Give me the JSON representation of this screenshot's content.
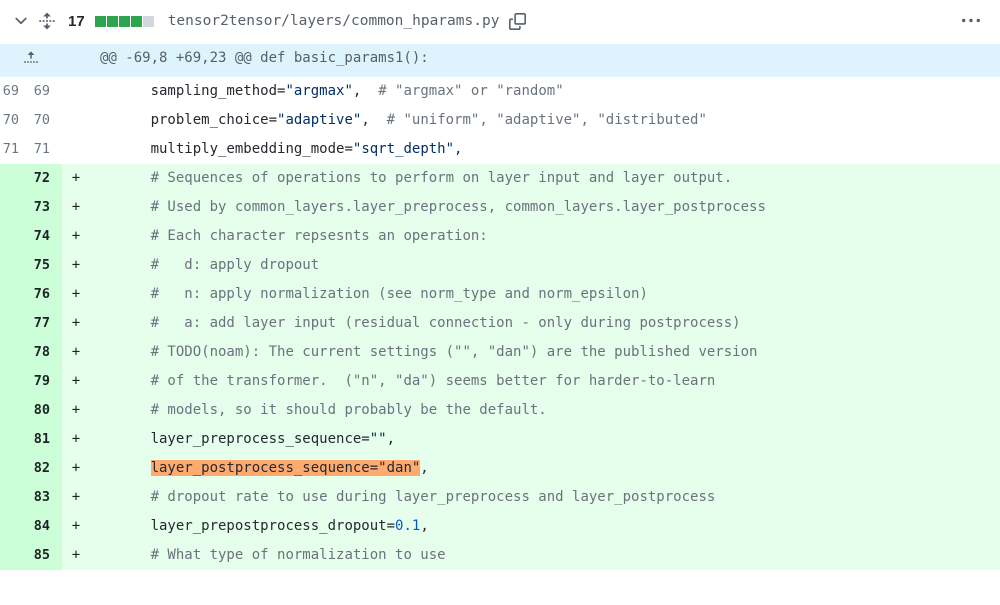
{
  "header": {
    "change_count": "17",
    "file_path": "tensor2tensor/layers/common_hparams.py"
  },
  "hunk_header": "@@ -69,8 +69,23 @@ def basic_params1():",
  "lines": [
    {
      "old": "69",
      "new": "69",
      "type": "context",
      "marker": "",
      "segs": [
        {
          "t": "      "
        },
        {
          "cls": "tok-param",
          "t": "sampling_method"
        },
        {
          "t": "="
        },
        {
          "cls": "tok-str",
          "t": "\"argmax\""
        },
        {
          "t": ",  "
        },
        {
          "cls": "tok-comment",
          "t": "# \"argmax\" or \"random\""
        }
      ]
    },
    {
      "old": "70",
      "new": "70",
      "type": "context",
      "marker": "",
      "segs": [
        {
          "t": "      "
        },
        {
          "cls": "tok-param",
          "t": "problem_choice"
        },
        {
          "t": "="
        },
        {
          "cls": "tok-str",
          "t": "\"adaptive\""
        },
        {
          "t": ",  "
        },
        {
          "cls": "tok-comment",
          "t": "# \"uniform\", \"adaptive\", \"distributed\""
        }
      ]
    },
    {
      "old": "71",
      "new": "71",
      "type": "context",
      "marker": "",
      "segs": [
        {
          "t": "      "
        },
        {
          "cls": "tok-param",
          "t": "multiply_embedding_mode"
        },
        {
          "t": "="
        },
        {
          "cls": "tok-str",
          "t": "\"sqrt_depth\""
        },
        {
          "t": ","
        }
      ]
    },
    {
      "old": "",
      "new": "72",
      "type": "addition",
      "marker": "+",
      "segs": [
        {
          "t": "      "
        },
        {
          "cls": "tok-comment",
          "t": "# Sequences of operations to perform on layer input and layer output."
        }
      ]
    },
    {
      "old": "",
      "new": "73",
      "type": "addition",
      "marker": "+",
      "segs": [
        {
          "t": "      "
        },
        {
          "cls": "tok-comment",
          "t": "# Used by common_layers.layer_preprocess, common_layers.layer_postprocess"
        }
      ]
    },
    {
      "old": "",
      "new": "74",
      "type": "addition",
      "marker": "+",
      "segs": [
        {
          "t": "      "
        },
        {
          "cls": "tok-comment",
          "t": "# Each character repsesnts an operation:"
        }
      ]
    },
    {
      "old": "",
      "new": "75",
      "type": "addition",
      "marker": "+",
      "segs": [
        {
          "t": "      "
        },
        {
          "cls": "tok-comment",
          "t": "#   d: apply dropout"
        }
      ]
    },
    {
      "old": "",
      "new": "76",
      "type": "addition",
      "marker": "+",
      "segs": [
        {
          "t": "      "
        },
        {
          "cls": "tok-comment",
          "t": "#   n: apply normalization (see norm_type and norm_epsilon)"
        }
      ]
    },
    {
      "old": "",
      "new": "77",
      "type": "addition",
      "marker": "+",
      "segs": [
        {
          "t": "      "
        },
        {
          "cls": "tok-comment",
          "t": "#   a: add layer input (residual connection - only during postprocess)"
        }
      ]
    },
    {
      "old": "",
      "new": "78",
      "type": "addition",
      "marker": "+",
      "segs": [
        {
          "t": "      "
        },
        {
          "cls": "tok-comment",
          "t": "# TODO(noam): The current settings (\"\", \"dan\") are the published version"
        }
      ]
    },
    {
      "old": "",
      "new": "79",
      "type": "addition",
      "marker": "+",
      "segs": [
        {
          "t": "      "
        },
        {
          "cls": "tok-comment",
          "t": "# of the transformer.  (\"n\", \"da\") seems better for harder-to-learn"
        }
      ]
    },
    {
      "old": "",
      "new": "80",
      "type": "addition",
      "marker": "+",
      "segs": [
        {
          "t": "      "
        },
        {
          "cls": "tok-comment",
          "t": "# models, so it should probably be the default."
        }
      ]
    },
    {
      "old": "",
      "new": "81",
      "type": "addition",
      "marker": "+",
      "segs": [
        {
          "t": "      "
        },
        {
          "cls": "tok-param",
          "t": "layer_preprocess_sequence"
        },
        {
          "t": "="
        },
        {
          "cls": "tok-str",
          "t": "\"\""
        },
        {
          "t": ","
        }
      ]
    },
    {
      "old": "",
      "new": "82",
      "type": "addition",
      "marker": "+",
      "segs": [
        {
          "t": "      "
        },
        {
          "cls": "highlight-seg",
          "t": "layer_postprocess_sequence=\"dan\""
        },
        {
          "t": ","
        }
      ]
    },
    {
      "old": "",
      "new": "83",
      "type": "addition",
      "marker": "+",
      "segs": [
        {
          "t": "      "
        },
        {
          "cls": "tok-comment",
          "t": "# dropout rate to use during layer_preprocess and layer_postprocess"
        }
      ]
    },
    {
      "old": "",
      "new": "84",
      "type": "addition",
      "marker": "+",
      "segs": [
        {
          "t": "      "
        },
        {
          "cls": "tok-param",
          "t": "layer_prepostprocess_dropout"
        },
        {
          "t": "="
        },
        {
          "cls": "tok-num",
          "t": "0.1"
        },
        {
          "t": ","
        }
      ]
    },
    {
      "old": "",
      "new": "85",
      "type": "addition",
      "marker": "+",
      "segs": [
        {
          "t": "      "
        },
        {
          "cls": "tok-comment",
          "t": "# What type of normalization to use"
        }
      ]
    }
  ]
}
